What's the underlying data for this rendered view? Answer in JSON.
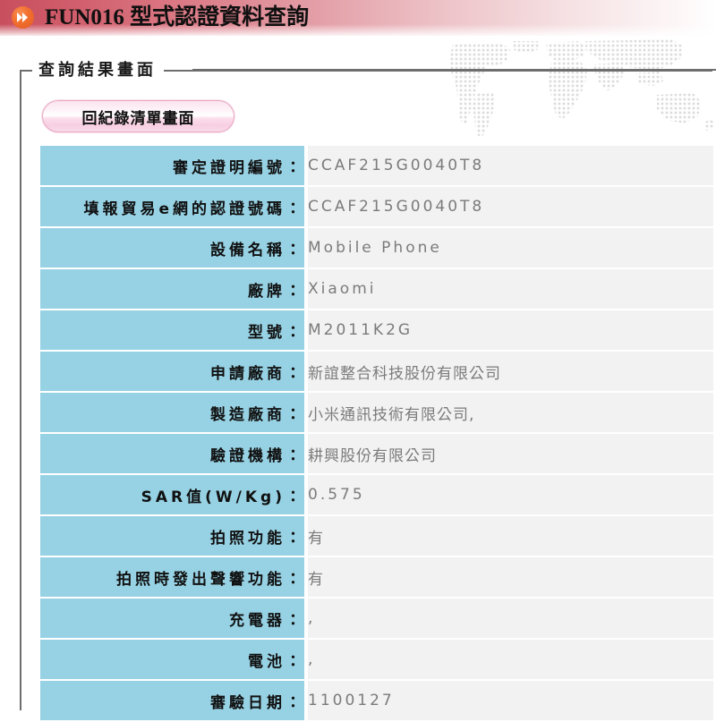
{
  "header": {
    "icon": "fast-forward-icon",
    "code": "FUN016",
    "title": "FUN016 型式認證資料查詢",
    "accent_color": "#c84f5e",
    "icon_color": "#f2702f"
  },
  "panel": {
    "legend": "查詢結果畫面",
    "border_color": "#6e6e6e"
  },
  "buttons": {
    "back_to_list": "回紀錄清單畫面"
  },
  "table": {
    "label_bg": "#97d2e4",
    "value_bg": "#f2f2f2",
    "rows": [
      {
        "label": "審定證明編號",
        "value": "CCAF215G0040T8",
        "cjk": false
      },
      {
        "label": "填報貿易e網的認證號碼",
        "value": "CCAF215G0040T8",
        "cjk": false
      },
      {
        "label": "設備名稱",
        "value": "Mobile Phone",
        "cjk": false
      },
      {
        "label": "廠牌",
        "value": "Xiaomi",
        "cjk": false
      },
      {
        "label": "型號",
        "value": "M2011K2G",
        "cjk": false
      },
      {
        "label": "申請廠商",
        "value": "新誼整合科技股份有限公司",
        "cjk": true
      },
      {
        "label": "製造廠商",
        "value": "小米通訊技術有限公司,",
        "cjk": true
      },
      {
        "label": "驗證機構",
        "value": "耕興股份有限公司",
        "cjk": true
      },
      {
        "label": "SAR值(W/Kg)",
        "value": "0.575",
        "cjk": false
      },
      {
        "label": "拍照功能",
        "value": "有",
        "cjk": true
      },
      {
        "label": "拍照時發出聲響功能",
        "value": "有",
        "cjk": true
      },
      {
        "label": "充電器",
        "value": ",",
        "cjk": false
      },
      {
        "label": "電池",
        "value": ",",
        "cjk": false
      },
      {
        "label": "審驗日期",
        "value": "1100127",
        "cjk": false
      }
    ]
  }
}
